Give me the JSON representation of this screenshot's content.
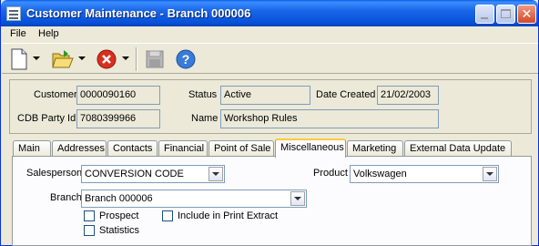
{
  "window": {
    "title": "Customer Maintenance - Branch 000006"
  },
  "menu": [
    {
      "label": "File"
    },
    {
      "label": "Help"
    }
  ],
  "toolbar": {
    "new_icon": "new-document-icon",
    "open_icon": "open-folder-icon",
    "delete_icon": "delete-icon",
    "save_icon": "save-icon",
    "help_icon": "help-icon"
  },
  "header": {
    "customer_label": "Customer",
    "customer_value": "0000090160",
    "cdb_label": "CDB Party Id",
    "cdb_value": "7080399966",
    "status_label": "Status",
    "status_value": "Active",
    "date_label": "Date Created",
    "date_value": "21/02/2003",
    "name_label": "Name",
    "name_value": "Workshop Rules"
  },
  "tabs": [
    {
      "label": "Main"
    },
    {
      "label": "Addresses"
    },
    {
      "label": "Contacts"
    },
    {
      "label": "Financial"
    },
    {
      "label": "Point of Sale"
    },
    {
      "label": "Miscellaneous"
    },
    {
      "label": "Marketing"
    },
    {
      "label": "External Data Update"
    }
  ],
  "misc": {
    "salesperson_label": "Salesperson",
    "salesperson_value": "CONVERSION CODE",
    "product_label": "Product",
    "product_value": "Volkswagen",
    "branch_label": "Branch",
    "branch_value": "Branch 000006",
    "prospect_label": "Prospect",
    "include_label": "Include in Print Extract",
    "statistics_label": "Statistics"
  }
}
